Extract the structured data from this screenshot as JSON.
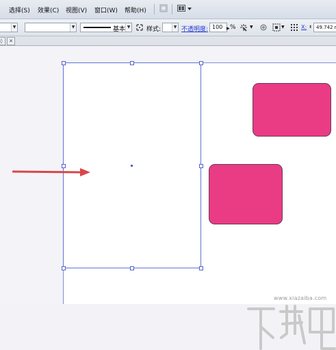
{
  "menu": {
    "items": [
      {
        "label": "选择(S)"
      },
      {
        "label": "效果(C)"
      },
      {
        "label": "视图(V)"
      },
      {
        "label": "窗口(W)"
      },
      {
        "label": "帮助(H)"
      }
    ],
    "icons": [
      "bridge-icon",
      "arrange-documents-icon"
    ]
  },
  "control_bar": {
    "stroke_profile_label": "基本",
    "style_label": "样式:",
    "opacity_label": "不透明度:",
    "opacity_value": "100",
    "opacity_unit": "%",
    "x_label": "X:",
    "x_value": "49.742 m"
  },
  "tabs": {
    "pieces": [
      "◊",
      "✕"
    ]
  },
  "canvas": {
    "shape_fill": "#ea3b85",
    "selection_color": "#5f73d0",
    "arrow_color": "#d9454b"
  },
  "watermark": {
    "url": "www.xiazaiba.com"
  }
}
